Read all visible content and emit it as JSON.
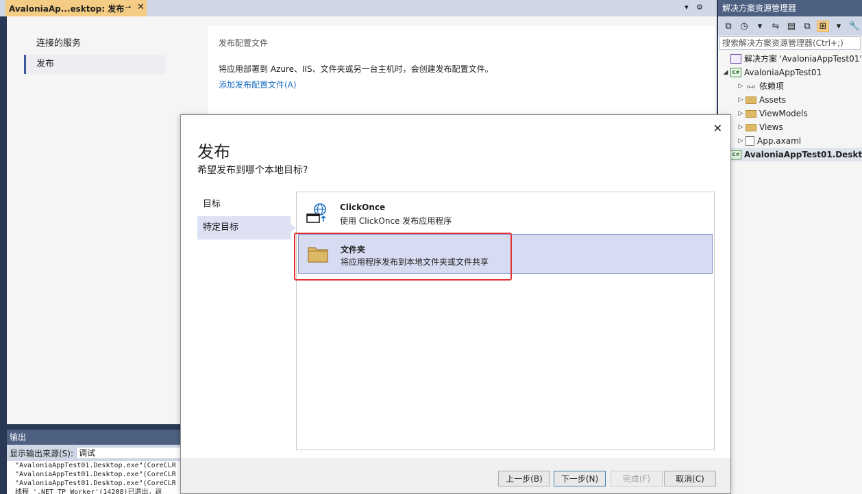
{
  "document_tab": {
    "title": "AvaloniaAp...esktop: 发布",
    "pin_glyph": "⊸",
    "close_glyph": "✕",
    "tools_glyphs": "▾ ⚙"
  },
  "publish_page": {
    "nav": [
      {
        "label": "连接的服务"
      },
      {
        "label": "发布"
      }
    ],
    "profile_card": {
      "title": "发布配置文件",
      "description": "将应用部署到 Azure、IIS、文件夹或另一台主机时，会创建发布配置文件。",
      "add_link": "添加发布配置文件(A)"
    }
  },
  "output_panel": {
    "title": "输出",
    "source_label": "显示输出来源(S):",
    "source_value": "调试",
    "lines": [
      "\"AvaloniaAppTest01.Desktop.exe\"(CoreCLR",
      "\"AvaloniaAppTest01.Desktop.exe\"(CoreCLR",
      "\"AvaloniaAppTest01.Desktop.exe\"(CoreCLR",
      "线程 '.NET TP Worker'(14208)已退出，返"
    ]
  },
  "solution_explorer": {
    "title": "解决方案资源管理器",
    "search_placeholder": "搜索解决方案资源管理器(Ctrl+;)",
    "toolbar_glyphs": [
      "⧉",
      "◷",
      "▾",
      "⇋",
      "▤",
      "⧉",
      "⊞",
      "▾",
      "🔧"
    ],
    "tree": [
      {
        "label": "解决方案 'AvaloniaAppTest01'",
        "icon": "solution-icon",
        "expander": ""
      },
      {
        "label": "AvaloniaAppTest01",
        "icon": "csharp-project-icon",
        "expander": "◢"
      },
      {
        "label": "依赖项",
        "icon": "dependencies-icon",
        "expander": "▷"
      },
      {
        "label": "Assets",
        "icon": "folder-icon",
        "expander": "▷"
      },
      {
        "label": "ViewModels",
        "icon": "folder-icon",
        "expander": "▷"
      },
      {
        "label": "Views",
        "icon": "folder-icon",
        "expander": "▷"
      },
      {
        "label": "App.axaml",
        "icon": "file-icon",
        "expander": "▷"
      },
      {
        "label": "AvaloniaAppTest01.Deskt",
        "icon": "csharp-project-icon",
        "expander": ""
      }
    ],
    "cs_glyph": "C#"
  },
  "dialog": {
    "close_glyph": "✕",
    "title": "发布",
    "subtitle": "希望发布到哪个本地目标?",
    "nav": [
      {
        "label": "目标"
      },
      {
        "label": "特定目标"
      }
    ],
    "targets": [
      {
        "name": "ClickOnce",
        "description": "使用 ClickOnce 发布应用程序",
        "icon": "clickonce-icon"
      },
      {
        "name": "文件夹",
        "description": "将应用程序发布到本地文件夹或文件共享",
        "icon": "folder-icon"
      }
    ],
    "buttons": {
      "back": "上一步(B)",
      "next": "下一步(N)",
      "finish": "完成(F)",
      "cancel": "取消(C)"
    }
  },
  "colors": {
    "accent_tab": "#f5cc84",
    "panel_header": "#4d6082",
    "selection": "#d8dcf3",
    "link": "#1a6cc4",
    "highlight_box": "#e53232"
  }
}
